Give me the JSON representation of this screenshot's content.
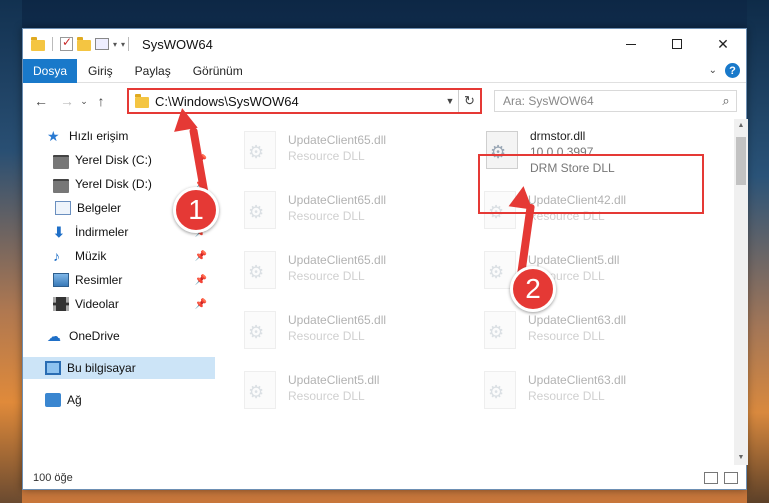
{
  "window": {
    "title": "SysWOW64",
    "min_label": "",
    "max_label": "",
    "close_label": "✕"
  },
  "ribbon": {
    "tabs": [
      "Dosya",
      "Giriş",
      "Paylaş",
      "Görünüm"
    ],
    "help": "?"
  },
  "nav": {
    "back": "←",
    "forward": "→",
    "recent": "⌄",
    "up": "↑",
    "address": "C:\\Windows\\SysWOW64",
    "refresh": "↻",
    "search_placeholder": "Ara: SysWOW64",
    "search_icon": "⌕"
  },
  "sidebar": {
    "items": [
      {
        "label": "Hızlı erişim",
        "icon": "star-icon"
      },
      {
        "label": "Yerel Disk (C:)",
        "icon": "disk-icon",
        "pinned": true
      },
      {
        "label": "Yerel Disk (D:)",
        "icon": "disk-icon",
        "pinned": true
      },
      {
        "label": "Belgeler",
        "icon": "document-icon",
        "pinned": true
      },
      {
        "label": "İndirmeler",
        "icon": "download-icon",
        "pinned": true
      },
      {
        "label": "Müzik",
        "icon": "music-icon",
        "pinned": true
      },
      {
        "label": "Resimler",
        "icon": "pictures-icon",
        "pinned": true
      },
      {
        "label": "Videolar",
        "icon": "video-icon",
        "pinned": true
      },
      {
        "label": "OneDrive",
        "icon": "cloud-icon"
      },
      {
        "label": "Bu bilgisayar",
        "icon": "computer-icon",
        "selected": true
      },
      {
        "label": "Ağ",
        "icon": "network-icon"
      }
    ]
  },
  "files": [
    {
      "name": "UpdateClient65.dll",
      "sub": "Resource DLL",
      "faded": true
    },
    {
      "name": "drmstor.dll",
      "sub": "10.0.0.3997",
      "sub2": "DRM Store DLL",
      "faded": false
    },
    {
      "name": "UpdateClient65.dll",
      "sub": "Resource DLL",
      "faded": true
    },
    {
      "name": "UpdateClient42.dll",
      "sub": "Resource DLL",
      "faded": true
    },
    {
      "name": "UpdateClient65.dll",
      "sub": "Resource DLL",
      "faded": true
    },
    {
      "name": "UpdateClient5.dll",
      "sub": "Resource DLL",
      "faded": true
    },
    {
      "name": "UpdateClient65.dll",
      "sub": "Resource DLL",
      "faded": true
    },
    {
      "name": "UpdateClient63.dll",
      "sub": "Resource DLL",
      "faded": true
    },
    {
      "name": "UpdateClient5.dll",
      "sub": "Resource DLL",
      "faded": true
    },
    {
      "name": "UpdateClient63.dll",
      "sub": "Resource DLL",
      "faded": true
    }
  ],
  "status": {
    "count": "100 öğe"
  },
  "annotations": {
    "step1": "1",
    "step2": "2"
  },
  "colors": {
    "accent": "#1979ca",
    "annotation": "#e53935",
    "selection": "#cce4f7"
  }
}
